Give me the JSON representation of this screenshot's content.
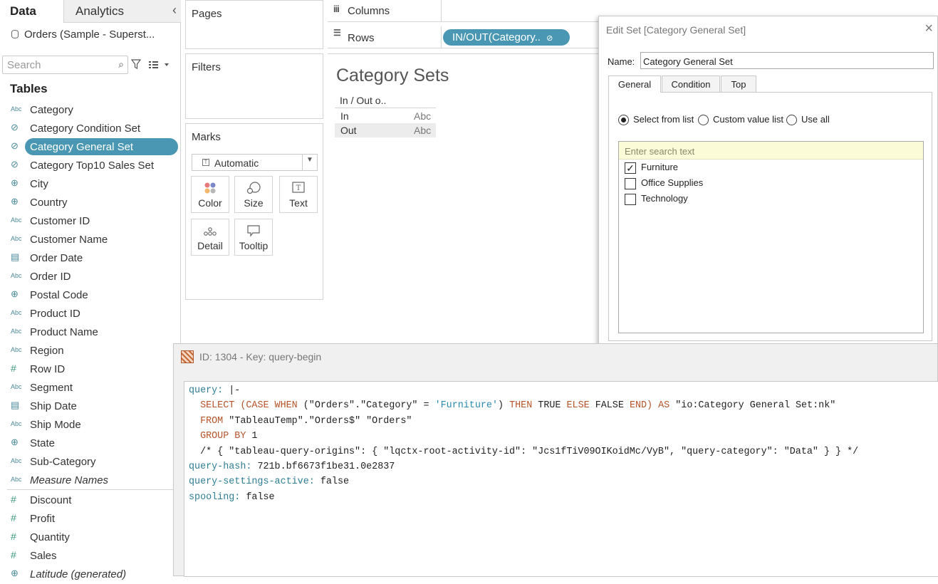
{
  "left_pane": {
    "tab_data": "Data",
    "tab_analytics": "Analytics",
    "collapse_glyph": "‹",
    "datasource": "Orders (Sample - Superst...",
    "search_placeholder": "Search",
    "tables_heading": "Tables",
    "fields": [
      {
        "label": "Category",
        "type": "Abc"
      },
      {
        "label": "Category Condition Set",
        "type": "set"
      },
      {
        "label": "Category General Set",
        "type": "set",
        "selected": true
      },
      {
        "label": "Category Top10 Sales Set",
        "type": "set"
      },
      {
        "label": "City",
        "type": "geo"
      },
      {
        "label": "Country",
        "type": "geo"
      },
      {
        "label": "Customer ID",
        "type": "Abc"
      },
      {
        "label": "Customer Name",
        "type": "Abc"
      },
      {
        "label": "Order Date",
        "type": "date"
      },
      {
        "label": "Order ID",
        "type": "Abc"
      },
      {
        "label": "Postal Code",
        "type": "geo"
      },
      {
        "label": "Product ID",
        "type": "Abc"
      },
      {
        "label": "Product Name",
        "type": "Abc"
      },
      {
        "label": "Region",
        "type": "Abc"
      },
      {
        "label": "Row ID",
        "type": "#"
      },
      {
        "label": "Segment",
        "type": "Abc"
      },
      {
        "label": "Ship Date",
        "type": "date"
      },
      {
        "label": "Ship Mode",
        "type": "Abc"
      },
      {
        "label": "State",
        "type": "geo"
      },
      {
        "label": "Sub-Category",
        "type": "Abc"
      },
      {
        "label": "Measure Names",
        "type": "Abc",
        "italic": true
      }
    ],
    "measures": [
      {
        "label": "Discount",
        "type": "#"
      },
      {
        "label": "Profit",
        "type": "#"
      },
      {
        "label": "Quantity",
        "type": "#"
      },
      {
        "label": "Sales",
        "type": "#"
      },
      {
        "label": "Latitude (generated)",
        "type": "geo",
        "italic": true
      }
    ]
  },
  "shelves": {
    "pages": "Pages",
    "filters": "Filters",
    "marks": "Marks",
    "mark_type": "Automatic",
    "mark_buttons": [
      "Color",
      "Size",
      "Text",
      "Detail",
      "Tooltip"
    ],
    "columns": "Columns",
    "rows": "Rows",
    "rows_pill": "IN/OUT(Category.."
  },
  "view": {
    "title": "Category Sets",
    "header": "In / Out o..",
    "rows": [
      {
        "label": "In",
        "value": "Abc"
      },
      {
        "label": "Out",
        "value": "Abc"
      }
    ]
  },
  "edit_set": {
    "title": "Edit Set [Category General Set]",
    "close_glyph": "×",
    "name_label": "Name:",
    "name_value": "Category General Set",
    "tabs": [
      "General",
      "Condition",
      "Top"
    ],
    "options": [
      "Select from list",
      "Custom value list",
      "Use all"
    ],
    "search_placeholder": "Enter search text",
    "items": [
      {
        "label": "Furniture",
        "checked": true
      },
      {
        "label": "Office Supplies",
        "checked": false
      },
      {
        "label": "Technology",
        "checked": false
      }
    ]
  },
  "query_window": {
    "title": "ID: 1304 - Key: query-begin",
    "query_key": "query:",
    "query_val": "|-",
    "sql": {
      "select_kw": "SELECT",
      "case_kw": "(CASE WHEN",
      "cond_lhs": "(\"Orders\".\"Category\" =",
      "cond_str": "'Furniture'",
      "then_kw": ")",
      "then": "THEN",
      "true": "TRUE",
      "else": "ELSE",
      "false": "FALSE",
      "end": "END)",
      "as": "AS",
      "alias": "\"io:Category General Set:nk\"",
      "from_kw": "FROM",
      "from_val": "\"TableauTemp\".\"Orders$\" \"Orders\"",
      "group_kw": "GROUP BY",
      "group_val": "1",
      "comment": "/* { \"tableau-query-origins\": { \"lqctx-root-activity-id\": \"Jcs1fTiV09OIKoidMc/VyB\", \"query-category\": \"Data\" } } */"
    },
    "query_hash_key": "query-hash:",
    "query_hash_val": "721b.bf6673f1be31.0e2837",
    "settings_key": "query-settings-active:",
    "settings_val": "false",
    "spooling_key": "spooling:",
    "spooling_val": "false"
  }
}
